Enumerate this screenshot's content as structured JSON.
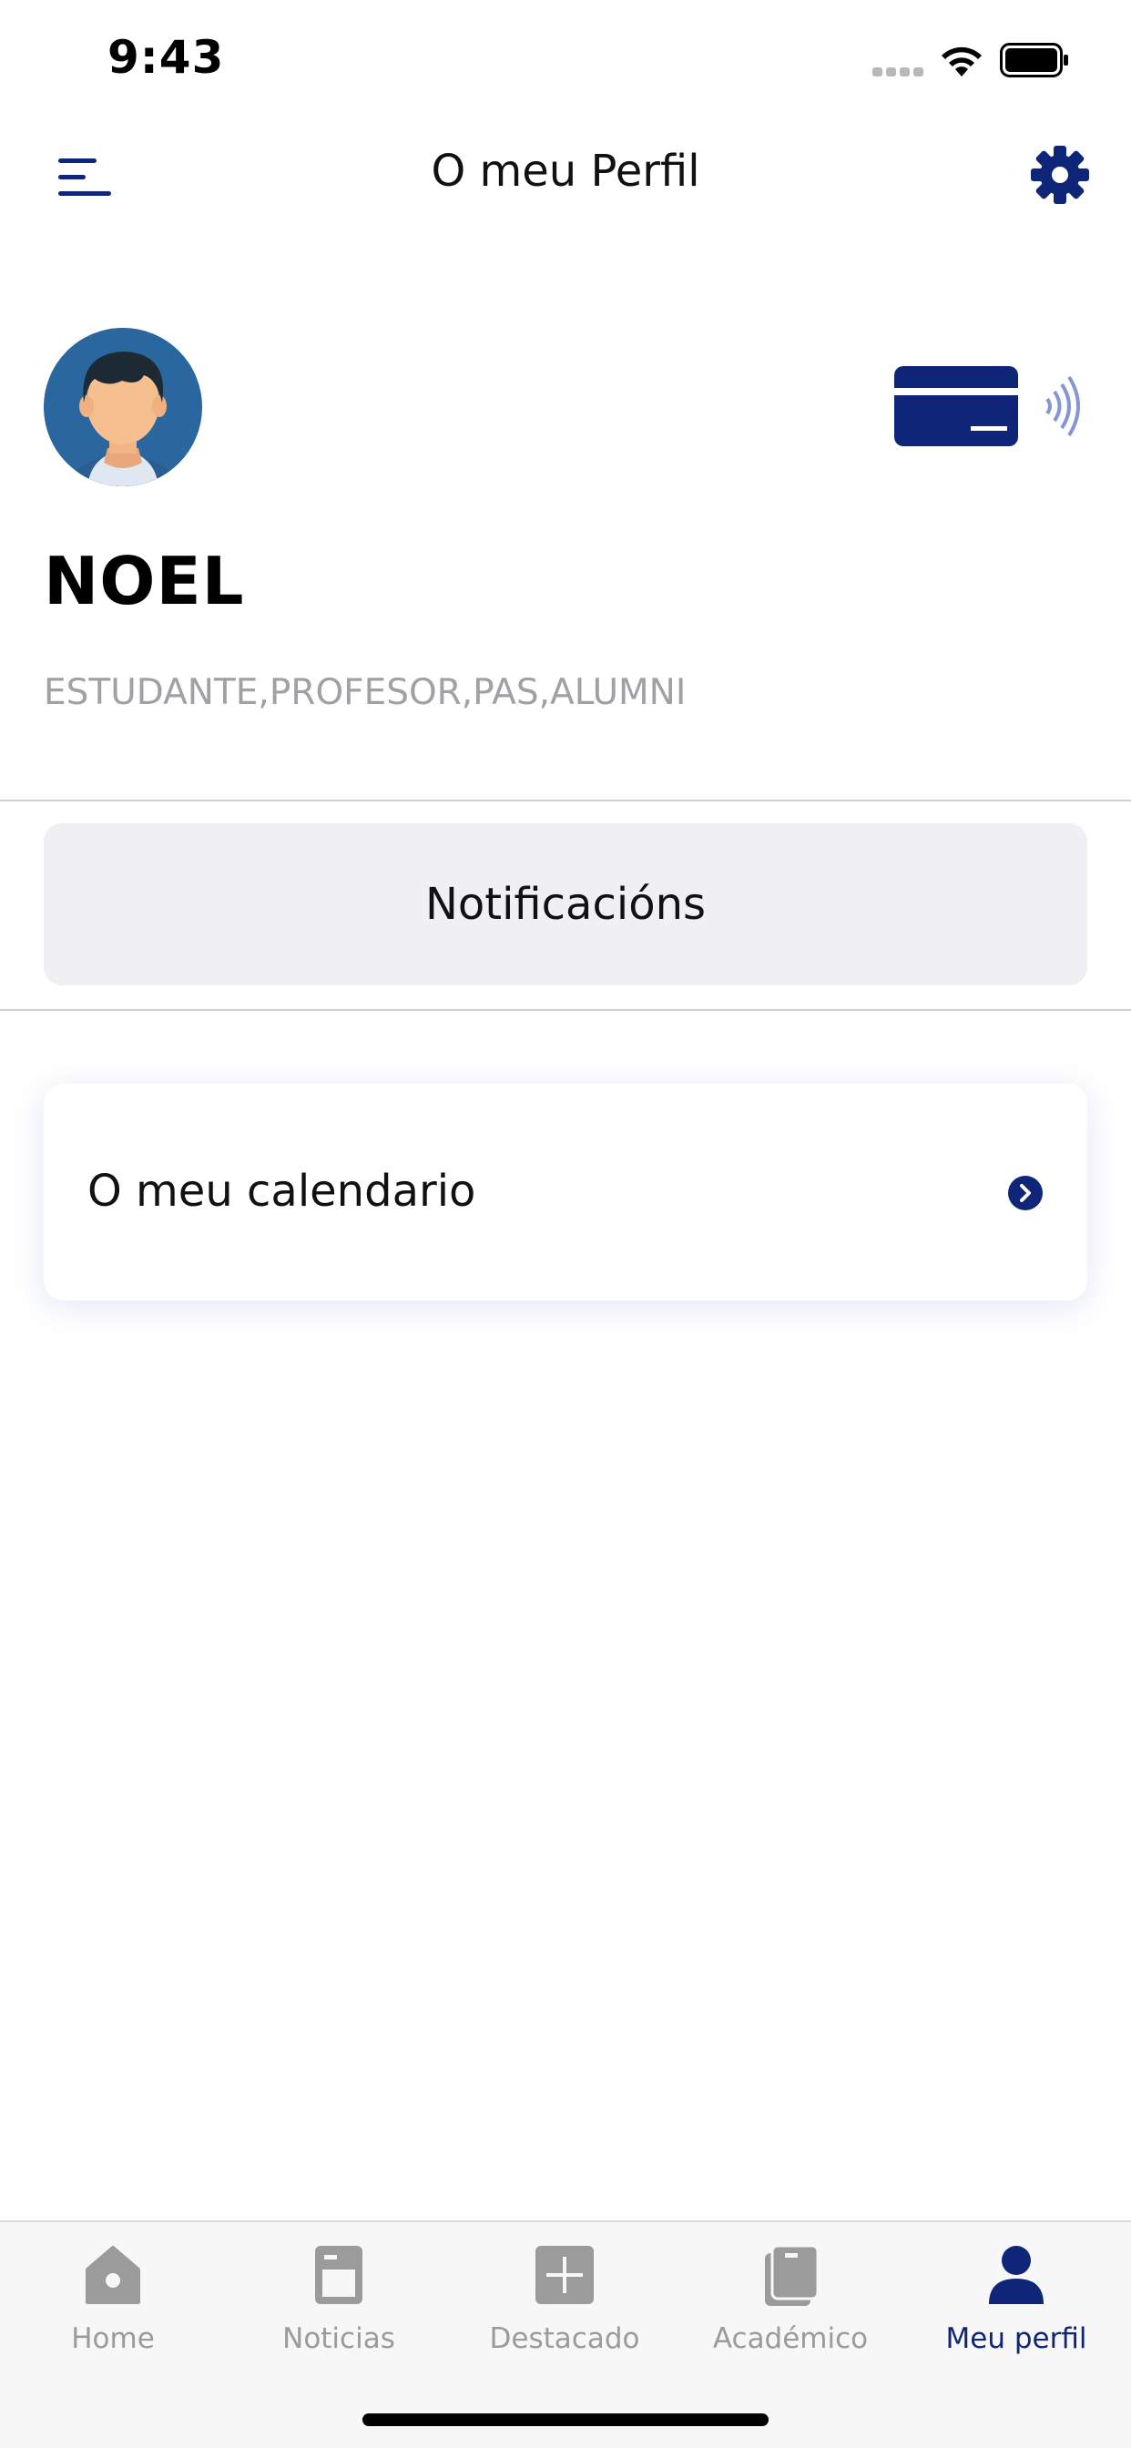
{
  "status_bar": {
    "time": "9:43"
  },
  "header": {
    "title": "O meu Perfil",
    "menu_icon": "hamburger-menu-icon",
    "settings_icon": "gear-icon"
  },
  "profile": {
    "name": "NOEL",
    "roles": "ESTUDANTE,PROFESOR,PAS,ALUMNI",
    "avatar_icon": "user-avatar-icon",
    "card_icon": "contactless-card-icon"
  },
  "notifications": {
    "label": "Notificacións"
  },
  "calendar": {
    "label": "O meu calendario",
    "chevron_icon": "chevron-right-circle-icon"
  },
  "tab_bar": {
    "items": [
      {
        "label": "Home",
        "icon": "home-icon"
      },
      {
        "label": "Noticias",
        "icon": "news-icon"
      },
      {
        "label": "Destacado",
        "icon": "plus-square-icon"
      },
      {
        "label": "Académico",
        "icon": "book-icon"
      },
      {
        "label": "Meu perfil",
        "icon": "person-icon",
        "active": true
      }
    ]
  },
  "colors": {
    "accent": "#0f2678",
    "inactive": "#9b9b9b",
    "secondary_text": "#a0a0a5",
    "button_bg": "#efeff4"
  }
}
